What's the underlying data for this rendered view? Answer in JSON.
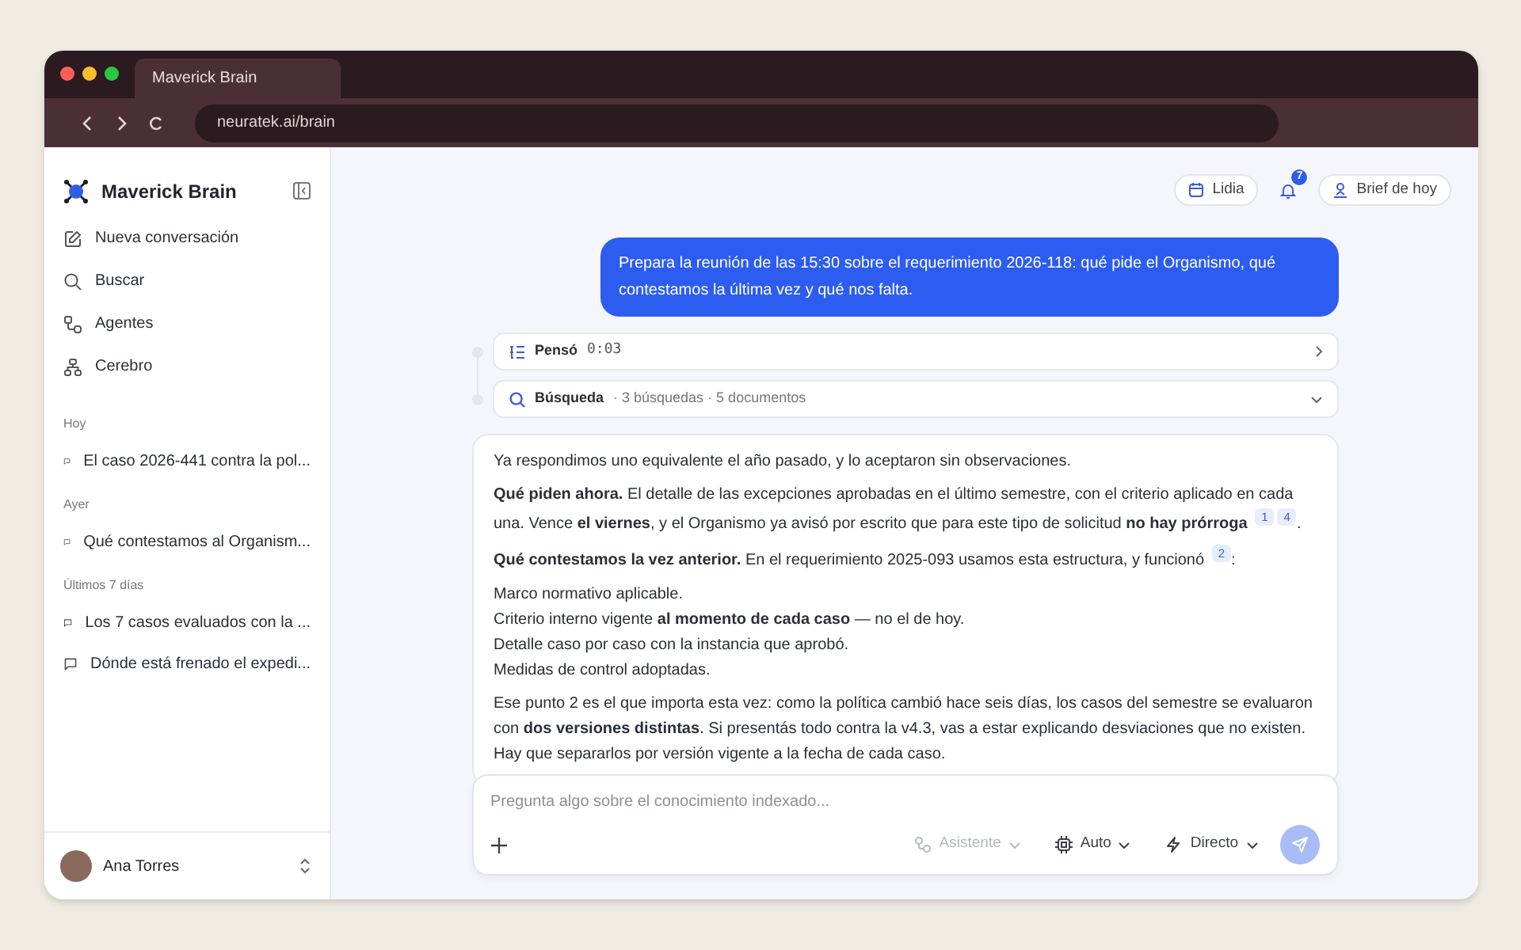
{
  "browser": {
    "tab_title": "Maverick Brain",
    "url": "neuratek.ai/brain"
  },
  "sidebar": {
    "brand": "Maverick Brain",
    "nav": [
      {
        "label": "Nueva conversación",
        "kind": "new"
      },
      {
        "label": "Buscar",
        "kind": "search"
      },
      {
        "label": "Agentes",
        "kind": "agents"
      },
      {
        "label": "Cerebro",
        "kind": "brain"
      }
    ],
    "sections": [
      {
        "title": "Hoy",
        "items": [
          "El caso 2026-441 contra la pol..."
        ]
      },
      {
        "title": "Ayer",
        "items": [
          "Qué contestamos al Organism..."
        ]
      },
      {
        "title": "Últimos 7 días",
        "items": [
          "Los 7 casos evaluados con la ...",
          "Dónde está frenado el expedi..."
        ]
      }
    ],
    "user": {
      "name": "Ana Torres"
    }
  },
  "topbar": {
    "contact": "Lidia",
    "notifications": "7",
    "brief": "Brief de hoy"
  },
  "user_message": "Prepara la reunión de las 15:30 sobre el requerimiento 2026-118: qué pide el Organismo, qué contestamos la última vez y qué nos falta.",
  "steps": [
    {
      "kind": "thought",
      "label": "Pensó",
      "detail": "0:03",
      "expanded": false
    },
    {
      "kind": "search",
      "label": "Búsqueda",
      "detail": "· 3 búsquedas · 5 documentos",
      "expanded": true
    }
  ],
  "answer": [
    {
      "kind": "paragraph",
      "text": "Ya respondimos uno equivalente el año pasado, y lo aceptaron sin observaciones."
    },
    {
      "kind": "paragraph",
      "text": "**Qué piden ahora.** El detalle de las excepciones aprobadas en el último semestre, con el criterio aplicado en cada una. Vence **el viernes**, y el Organismo ya avisó por escrito que para este tipo de solicitud **no hay prórroga**",
      "citations": [
        "1",
        "4"
      ],
      "suffix": "."
    },
    {
      "kind": "paragraph",
      "text": "**Qué contestamos la vez anterior.** En el requerimiento 2025-093 usamos esta estructura, y funcionó",
      "citations": [
        "2"
      ],
      "suffix": ":"
    },
    {
      "kind": "list",
      "items": [
        "Marco normativo aplicable.",
        "Criterio interno vigente **al momento de cada caso** — no el de hoy.",
        "Detalle caso por caso con la instancia que aprobó.",
        "Medidas de control adoptadas."
      ]
    },
    {
      "kind": "paragraph",
      "text": "Ese punto 2 es el que importa esta vez: como la política cambió hace seis días, los casos del semestre se evaluaron con **dos versiones distintas**. Si presentás todo contra la v4.3, vas a estar explicando desviaciones que no existen. Hay que separarlos por versión vigente a la fecha de cada caso."
    }
  ],
  "composer": {
    "placeholder": "Pregunta algo sobre el conocimiento indexado...",
    "options": [
      {
        "label": "Asistente",
        "kind": "assistant",
        "disabled": true
      },
      {
        "label": "Auto",
        "kind": "model",
        "disabled": false
      },
      {
        "label": "Directo",
        "kind": "mode",
        "disabled": false
      }
    ],
    "send_disabled": true
  }
}
